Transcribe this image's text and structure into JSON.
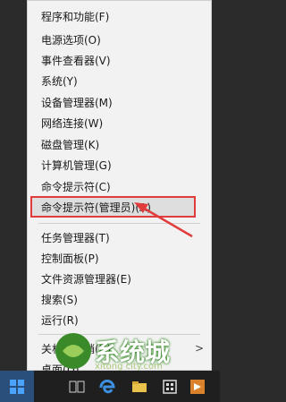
{
  "menu": {
    "items": [
      {
        "label": "程序和功能(F)"
      },
      {
        "label": "电源选项(O)"
      },
      {
        "label": "事件查看器(V)"
      },
      {
        "label": "系统(Y)"
      },
      {
        "label": "设备管理器(M)"
      },
      {
        "label": "网络连接(W)"
      },
      {
        "label": "磁盘管理(K)"
      },
      {
        "label": "计算机管理(G)"
      },
      {
        "label": "命令提示符(C)"
      },
      {
        "label": "命令提示符(管理员)(A)"
      },
      {
        "label": "任务管理器(T)"
      },
      {
        "label": "控制面板(P)"
      },
      {
        "label": "文件资源管理器(E)"
      },
      {
        "label": "搜索(S)"
      },
      {
        "label": "运行(R)"
      },
      {
        "label": "关机或注销(U)"
      },
      {
        "label": "桌面(D)"
      }
    ],
    "submenu_chevron": ">"
  },
  "watermark": {
    "text": "系统城",
    "url": "xitong city.com",
    "brand_color": "#3a8a2a"
  },
  "highlight_color": "#e03c3c",
  "taskbar": {
    "icons": [
      "windows-start-icon",
      "task-view-icon",
      "edge-icon",
      "file-explorer-icon",
      "store-icon",
      "app-icon"
    ]
  }
}
